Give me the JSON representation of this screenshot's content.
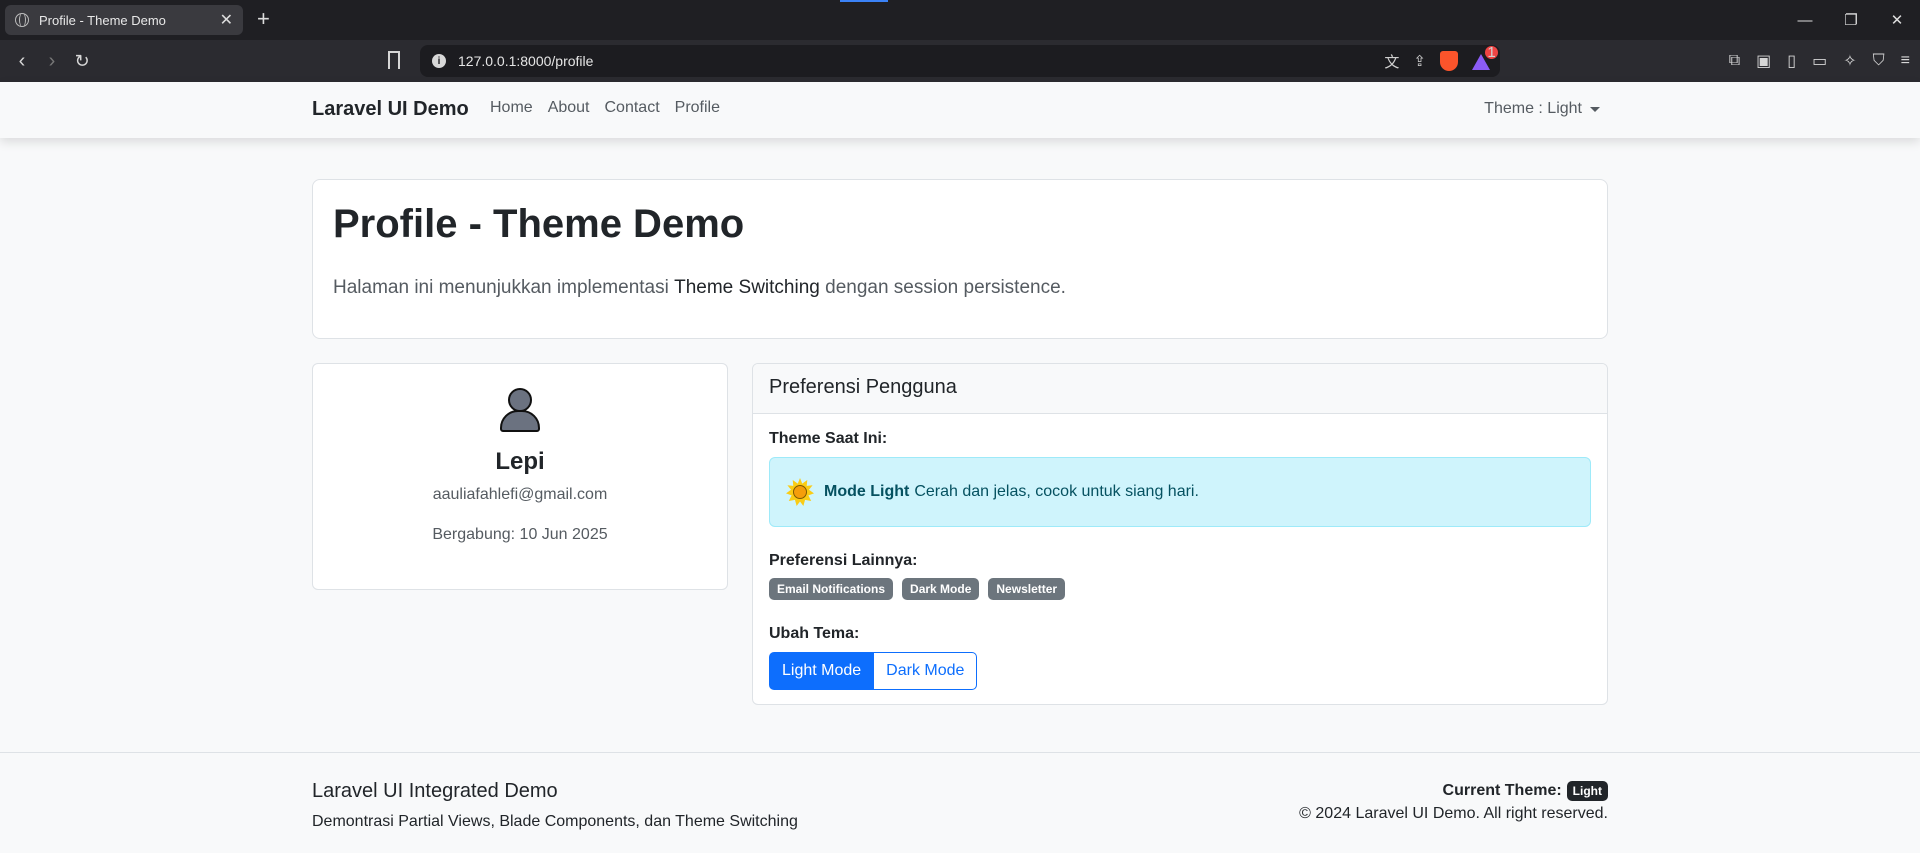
{
  "browser": {
    "tab_title": "Profile - Theme Demo",
    "url": "127.0.0.1:8000/profile",
    "rewards_badge": "1"
  },
  "navbar": {
    "brand": "Laravel UI Demo",
    "links": [
      "Home",
      "About",
      "Contact",
      "Profile"
    ],
    "theme_dropdown": "Theme : Light"
  },
  "hero": {
    "title": "Profile - Theme Demo",
    "desc_before": "Halaman ini menunjukkan implementasi ",
    "desc_emphasis": "Theme Switching",
    "desc_after": " dengan session persistence."
  },
  "profile": {
    "name": "Lepi",
    "email": "aauliafahlefi@gmail.com",
    "joined": "Bergabung: 10 Jun 2025"
  },
  "preferences": {
    "header": "Preferensi Pengguna",
    "current_theme_label": "Theme Saat Ini:",
    "alert_strong": "Mode Light",
    "alert_text": "Cerah dan jelas, cocok untuk siang hari.",
    "other_label": "Preferensi Lainnya:",
    "badges": [
      "Email Notifications",
      "Dark Mode",
      "Newsletter"
    ],
    "change_label": "Ubah Tema:",
    "light_button": "Light Mode",
    "dark_button": "Dark Mode"
  },
  "footer": {
    "title": "Laravel UI Integrated Demo",
    "subtitle": "Demontrasi Partial Views, Blade Components, dan Theme Switching",
    "current_theme_label": "Current Theme:",
    "current_theme_value": "Light",
    "copyright": "© 2024 Laravel UI Demo. All right reserved."
  },
  "colors": {
    "primary": "#0d6efd",
    "info_bg": "#cff4fc",
    "secondary_badge": "#6c757d"
  }
}
